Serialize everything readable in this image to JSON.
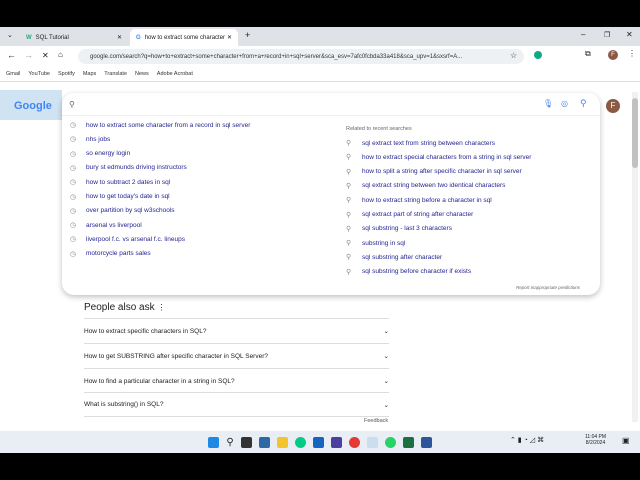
{
  "browser": {
    "tabs": [
      {
        "title": "SQL Tutorial",
        "favicon": "W"
      },
      {
        "title": "how to extract some character",
        "favicon": "G"
      }
    ],
    "url": "google.com/search?q=how+to+extract+some+character+from+a+record+in+sql+server&sca_esv=7afc0fcbda33a418&sca_upv=1&sxsrf=A...",
    "bookmarks": [
      "Gmail",
      "YouTube",
      "Spotify",
      "Maps",
      "Translate",
      "News",
      "Adobe Acrobat"
    ],
    "profile_initial": "F"
  },
  "search": {
    "value": "",
    "history": [
      "how to extract some character from a record in sql server",
      "nhs jobs",
      "so energy login",
      "bury st edmunds driving instructors",
      "how to subtract 2 dates in sql",
      "how to get today's date in sql",
      "over partition by sql w3schools",
      "arsenal vs liverpool",
      "liverpool f.c. vs arsenal f.c. lineups",
      "motorcycle parts sales"
    ],
    "related_heading": "Related to recent searches",
    "related": [
      "sql extract text from string between characters",
      "how to extract special characters from a string in sql server",
      "how to split a string after specific character in sql server",
      "sql extract string between two identical characters",
      "how to extract string before a character in sql",
      "sql extract part of string after character",
      "sql substring - last 3 characters",
      "substring in sql",
      "sql substring after character",
      "sql substring before character if exists"
    ],
    "report": "Report inappropriate predictions"
  },
  "paa": {
    "title": "People also ask",
    "questions": [
      "How to extract specific characters in SQL?",
      "How to get SUBSTRING after specific character in SQL Server?",
      "How to find a particular character in a string in SQL?",
      "What is substring() in SQL?"
    ],
    "feedback": "Feedback"
  },
  "taskbar": {
    "time": "11:04 PM",
    "date": "8/2/2024"
  }
}
